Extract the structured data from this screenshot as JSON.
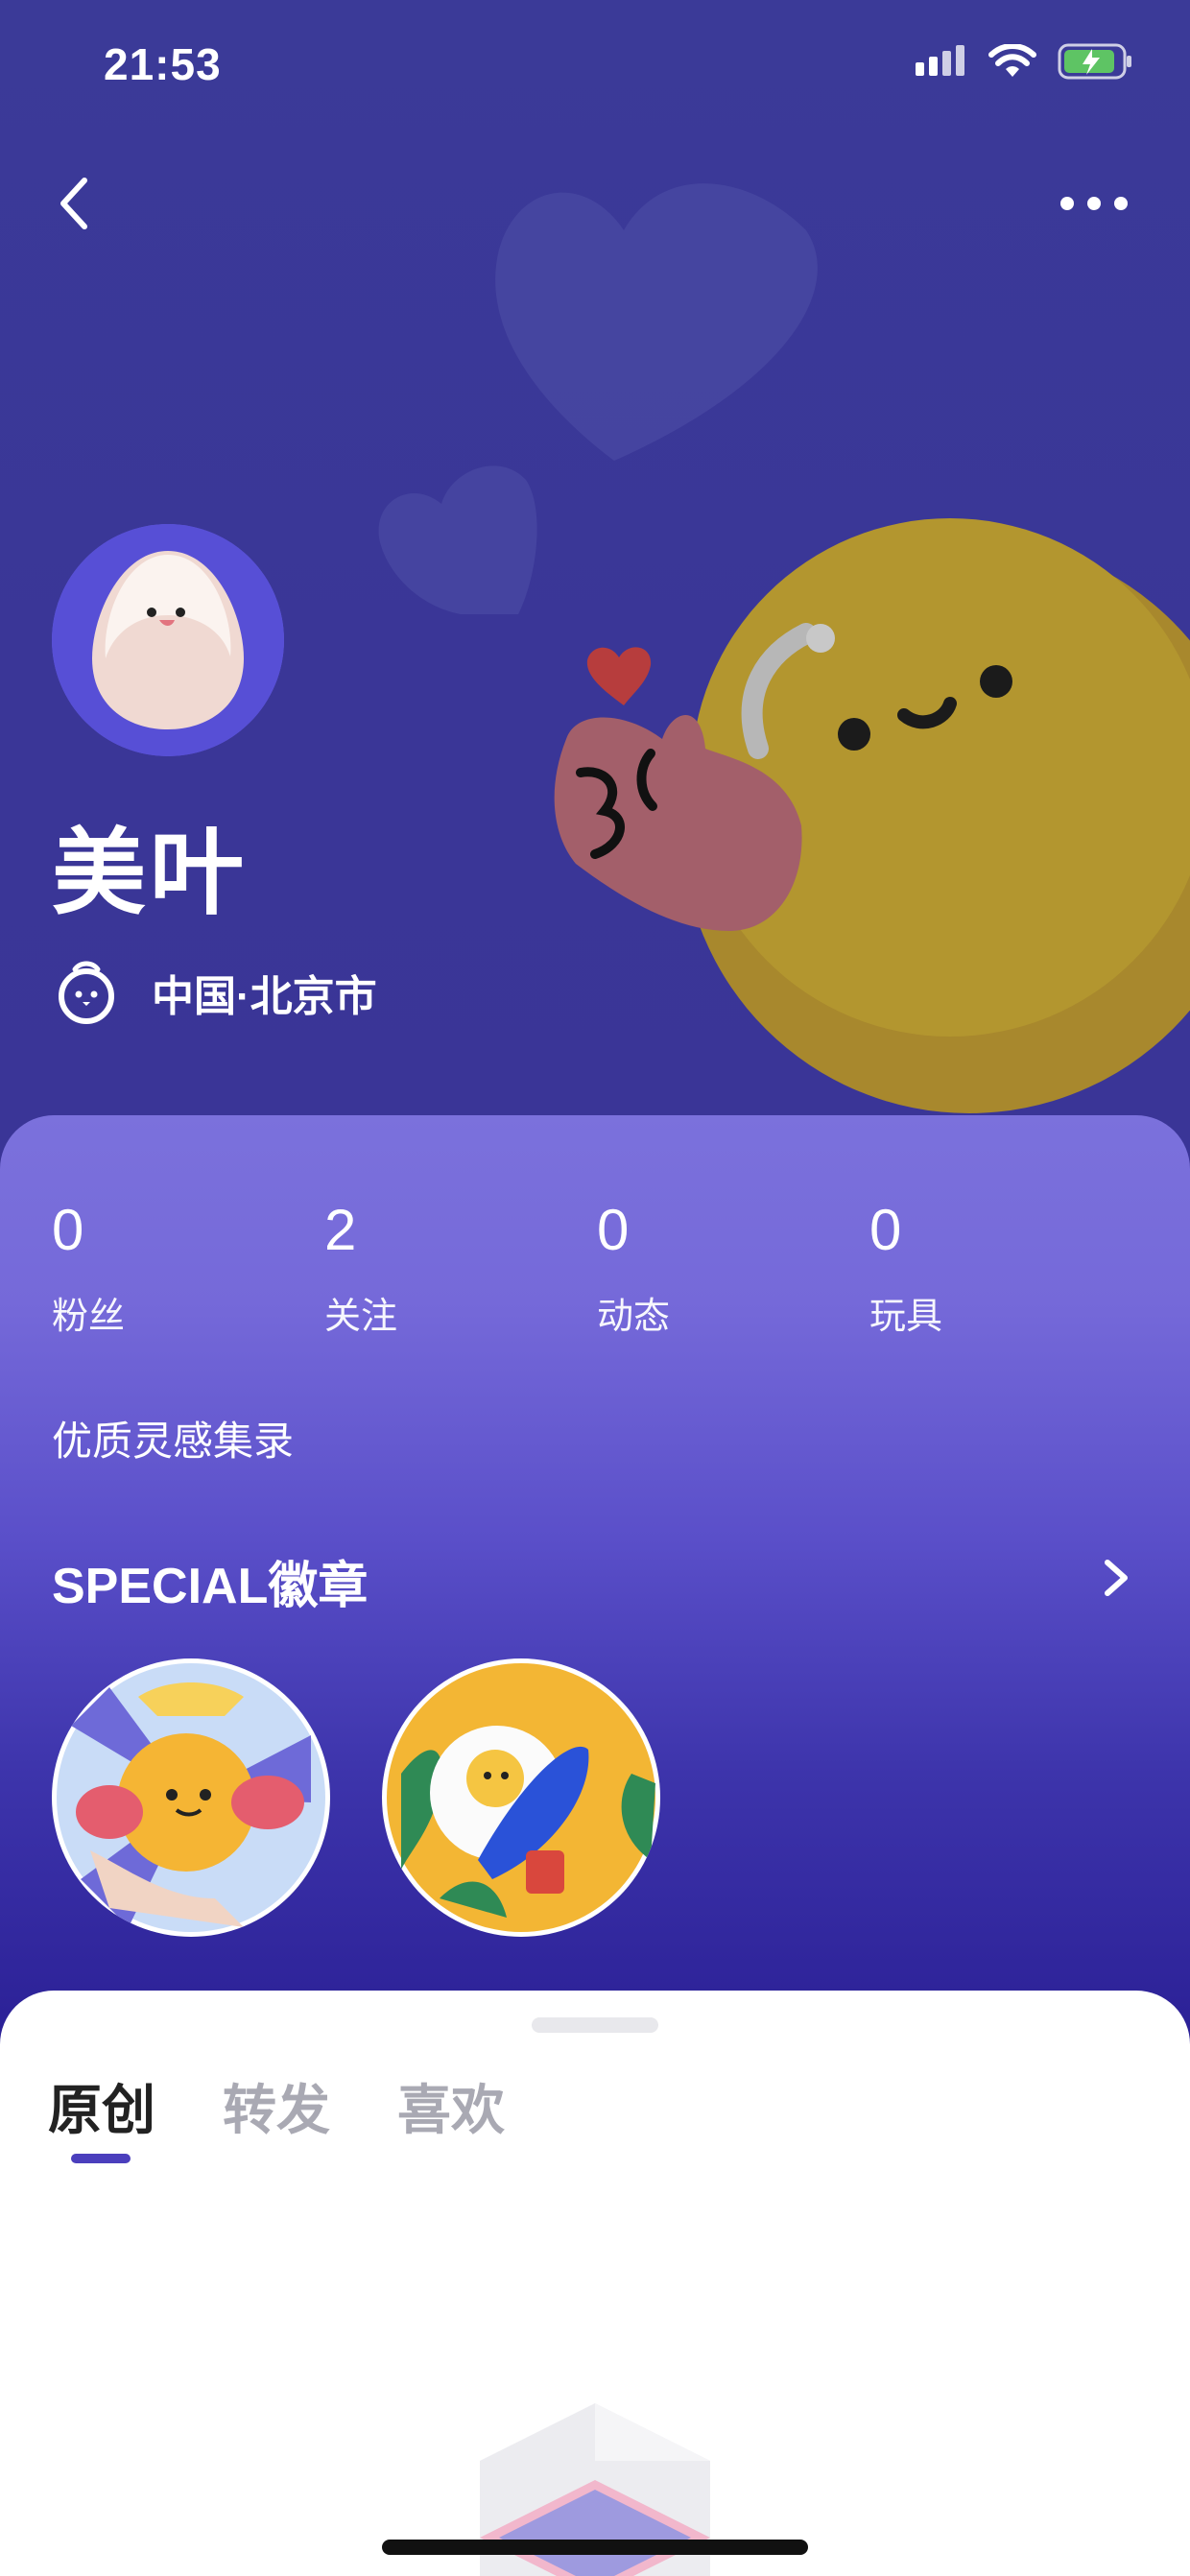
{
  "status_bar": {
    "time": "21:53"
  },
  "profile": {
    "name": "美叶",
    "location": "中国·北京市"
  },
  "stats": [
    {
      "value": "0",
      "label": "粉丝"
    },
    {
      "value": "2",
      "label": "关注"
    },
    {
      "value": "0",
      "label": "动态"
    },
    {
      "value": "0",
      "label": "玩具"
    }
  ],
  "inspiration_label": "优质灵感集录",
  "badges": {
    "title": "SPECIAL徽章"
  },
  "tabs": [
    {
      "label": "原创",
      "active": true
    },
    {
      "label": "转发",
      "active": false
    },
    {
      "label": "喜欢",
      "active": false
    }
  ],
  "icons": {
    "back": "chevron-left-icon",
    "more": "more-dots-icon",
    "location": "location-pin-icon",
    "badges_more": "chevron-right-icon"
  },
  "colors": {
    "header_bg": "#3a3697",
    "card_top": "#7b71dc",
    "card_bottom": "#2a1f95",
    "tab_active": "#222222",
    "tab_inactive": "#a9a9b3",
    "indicator": "#4b3fbd"
  }
}
